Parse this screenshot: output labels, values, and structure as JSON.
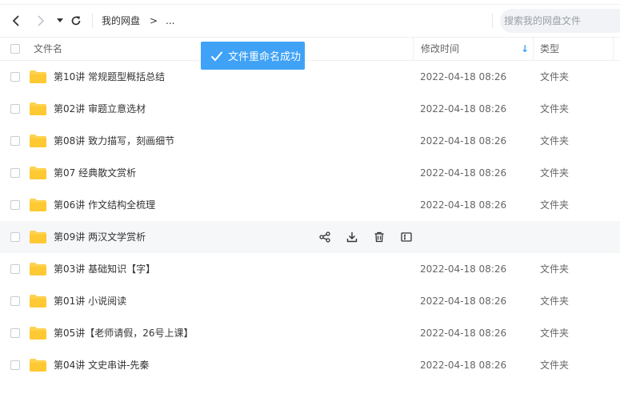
{
  "nav": {
    "breadcrumb_root": "我的网盘",
    "breadcrumb_sep": ">",
    "breadcrumb_more": "..."
  },
  "search": {
    "placeholder": "搜索我的网盘文件"
  },
  "table": {
    "columns": {
      "name": "文件名",
      "modified": "修改时间",
      "type": "类型"
    },
    "sort_indicator": "↓"
  },
  "toast": {
    "message": "文件重命名成功"
  },
  "files": [
    {
      "name": "第10讲 常规题型概括总结",
      "modified": "2022-04-18 08:26",
      "type": "文件夹"
    },
    {
      "name": "第02讲 审题立意选材",
      "modified": "2022-04-18 08:26",
      "type": "文件夹"
    },
    {
      "name": "第08讲 致力描写，刻画细节",
      "modified": "2022-04-18 08:26",
      "type": "文件夹"
    },
    {
      "name": "第07 经典散文赏析",
      "modified": "2022-04-18 08:26",
      "type": "文件夹"
    },
    {
      "name": "第06讲 作文结构全梳理",
      "modified": "2022-04-18 08:26",
      "type": "文件夹"
    },
    {
      "name": "第09讲 两汉文学赏析",
      "modified": "",
      "type": ""
    },
    {
      "name": "第03讲 基础知识【字】",
      "modified": "2022-04-18 08:26",
      "type": "文件夹"
    },
    {
      "name": "第01讲 小说阅读",
      "modified": "2022-04-18 08:26",
      "type": "文件夹"
    },
    {
      "name": "第05讲【老师请假，26号上课】",
      "modified": "2022-04-18 08:26",
      "type": "文件夹"
    },
    {
      "name": "第04讲 文史串讲-先秦",
      "modified": "2022-04-18 08:26",
      "type": "文件夹"
    }
  ],
  "colors": {
    "accent": "#3fa2f7",
    "folder": "#ffd24d",
    "hover_row": "#f6f7f9"
  }
}
